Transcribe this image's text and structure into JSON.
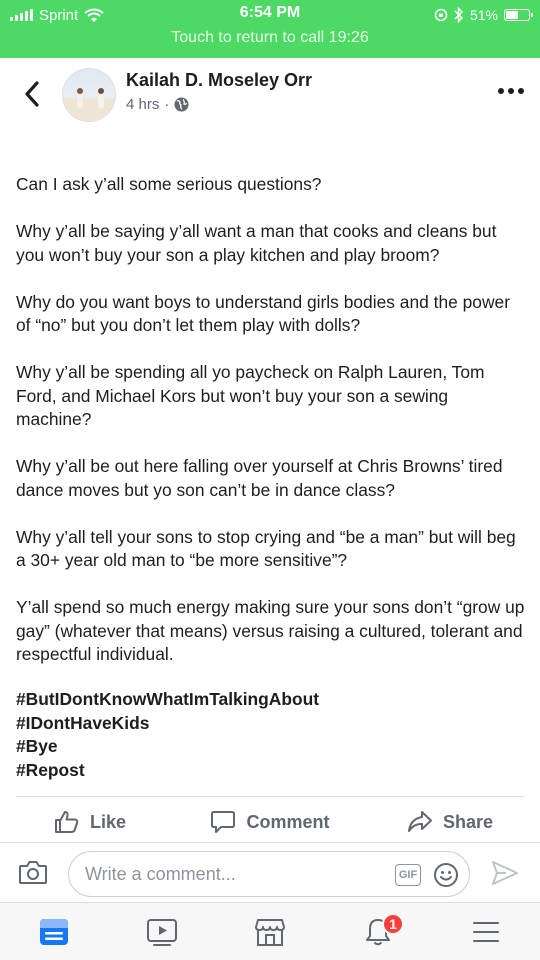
{
  "status_bar": {
    "carrier": "Sprint",
    "time": "6:54 PM",
    "battery_percent": "51%",
    "battery_level": 0.51,
    "call_banner": "Touch to return to call 19:26",
    "color": "#4cd964"
  },
  "post": {
    "author": "Kailah D. Moseley Orr",
    "time_ago": "4 hrs",
    "separator": "·",
    "privacy_icon": "globe-icon",
    "paragraphs": [
      "Can I ask y’all some serious questions?",
      "Why y’all be saying y’all want a man that cooks and cleans but you won’t buy your son a play kitchen and play broom?",
      "Why do you want boys to understand girls bodies and the power of “no” but you don’t let them play with dolls?",
      "Why y’all be spending all yo paycheck on Ralph Lauren, Tom Ford, and Michael Kors but won’t buy your son a sewing machine?",
      "Why y’all be out here falling over yourself at Chris Browns’ tired dance moves but yo son can’t be in dance class?",
      "Why y’all tell your sons to stop crying and “be a man” but will beg a 30+ year old man to “be more sensitive”?",
      "Y’all spend so much energy making sure your sons don’t “grow up gay” (whatever that means) versus raising a cultured, tolerant and respectful individual."
    ],
    "hashtags": [
      "#ButIDontKnowWhatImTalkingAbout",
      "#IDontHaveKids",
      "#Bye",
      "#Repost"
    ]
  },
  "actions": {
    "like": "Like",
    "comment": "Comment",
    "share": "Share"
  },
  "comment_bar": {
    "placeholder": "Write a comment...",
    "gif_label": "GIF"
  },
  "tab_bar": {
    "items": [
      "news-feed-icon",
      "watch-icon",
      "marketplace-icon",
      "notifications-icon",
      "menu-icon"
    ],
    "notification_count": "1",
    "active_color": "#1877f2",
    "badge_color": "#fa3e3e"
  }
}
